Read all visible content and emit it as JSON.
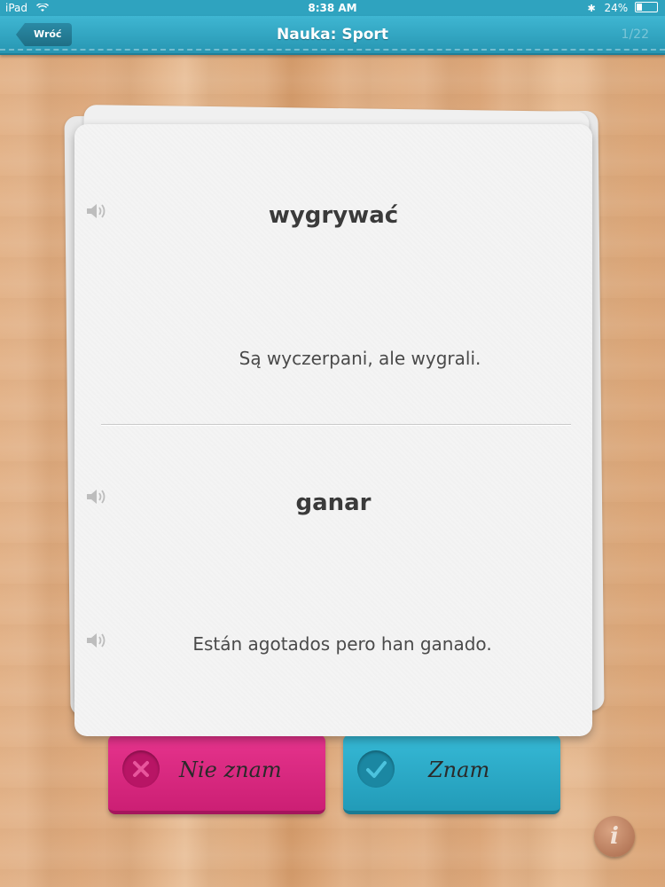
{
  "status_bar": {
    "device": "iPad",
    "time": "8:38 AM",
    "battery": "24%"
  },
  "nav": {
    "back_label": "Wróć",
    "title": "Nauka: Sport",
    "counter": "1/22"
  },
  "card": {
    "front": {
      "word": "wygrywać",
      "sentence": "Są wyczerpani, ale wygrali."
    },
    "back": {
      "word": "ganar",
      "sentence": "Están agotados pero han ganado."
    }
  },
  "buttons": {
    "dont_know": "Nie znam",
    "know": "Znam"
  },
  "info_label": "i",
  "colors": {
    "nav_teal": "#2fa3bf",
    "dont_know_pink": "#e0307f",
    "know_blue": "#2aa8c8"
  }
}
